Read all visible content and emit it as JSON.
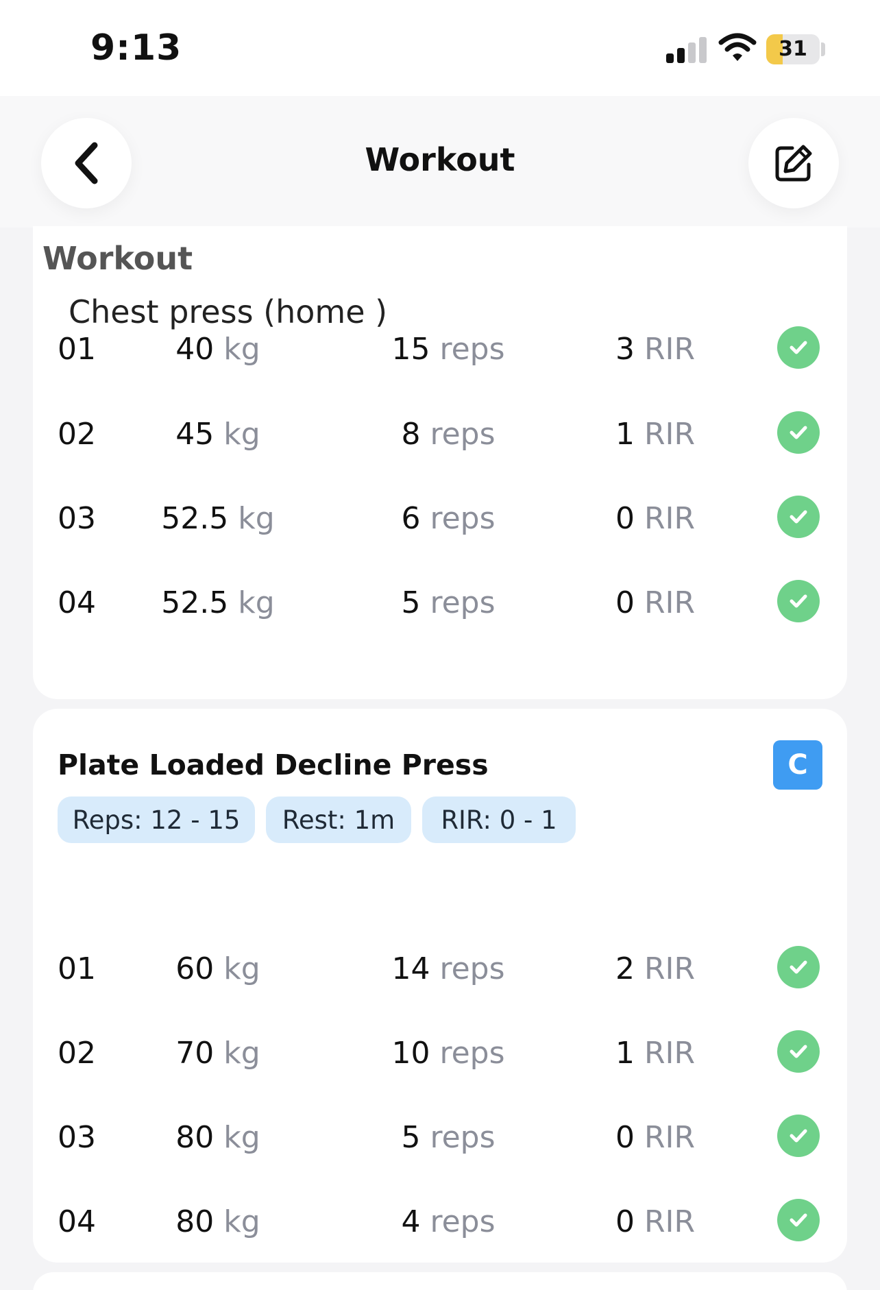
{
  "status_bar": {
    "time": "9:13",
    "battery": "31",
    "battery_level": 0.31
  },
  "header": {
    "title": "Workout",
    "back_icon": "chevron-left-icon",
    "edit_icon": "edit-icon"
  },
  "section_label": "Workout",
  "exercise1": {
    "name": "Chest press (home )",
    "sets": [
      {
        "num": "01",
        "weight": "40",
        "weight_unit": "kg",
        "reps": "15",
        "reps_unit": "reps",
        "rir": "3",
        "rir_unit": "RIR"
      },
      {
        "num": "02",
        "weight": "45",
        "weight_unit": "kg",
        "reps": "8",
        "reps_unit": "reps",
        "rir": "1",
        "rir_unit": "RIR"
      },
      {
        "num": "03",
        "weight": "52.5",
        "weight_unit": "kg",
        "reps": "6",
        "reps_unit": "reps",
        "rir": "0",
        "rir_unit": "RIR"
      },
      {
        "num": "04",
        "weight": "52.5",
        "weight_unit": "kg",
        "reps": "5",
        "reps_unit": "reps",
        "rir": "0",
        "rir_unit": "RIR"
      }
    ]
  },
  "exercise2": {
    "name": "Plate Loaded Decline Press",
    "badge": "C",
    "chips": [
      "Reps: 12 - 15",
      "Rest: 1m",
      "RIR: 0 - 1"
    ],
    "sets": [
      {
        "num": "01",
        "weight": "60",
        "weight_unit": "kg",
        "reps": "14",
        "reps_unit": "reps",
        "rir": "2",
        "rir_unit": "RIR"
      },
      {
        "num": "02",
        "weight": "70",
        "weight_unit": "kg",
        "reps": "10",
        "reps_unit": "reps",
        "rir": "1",
        "rir_unit": "RIR"
      },
      {
        "num": "03",
        "weight": "80",
        "weight_unit": "kg",
        "reps": "5",
        "reps_unit": "reps",
        "rir": "0",
        "rir_unit": "RIR"
      },
      {
        "num": "04",
        "weight": "80",
        "weight_unit": "kg",
        "reps": "4",
        "reps_unit": "reps",
        "rir": "0",
        "rir_unit": "RIR"
      }
    ]
  },
  "colors": {
    "check": "#6fd18a",
    "badge": "#3f9cf2",
    "chip": "#d8ebfb",
    "unit": "#8b8e99"
  }
}
